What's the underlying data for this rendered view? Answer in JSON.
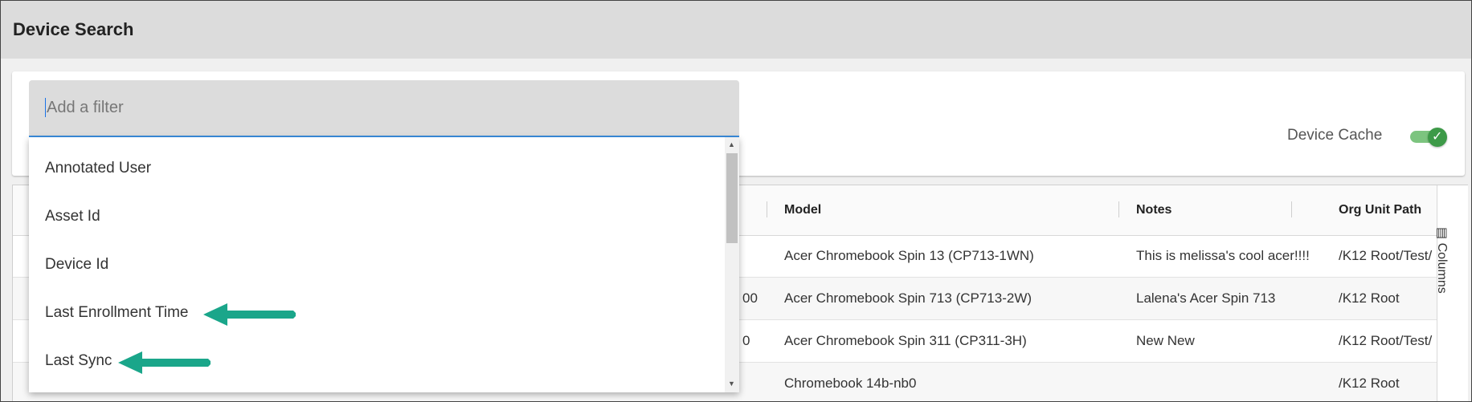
{
  "page": {
    "title": "Device Search"
  },
  "filter": {
    "placeholder": "Add a filter",
    "options": [
      "Annotated User",
      "Asset Id",
      "Device Id",
      "Last Enrollment Time",
      "Last Sync"
    ]
  },
  "device_cache": {
    "label": "Device Cache",
    "enabled": true
  },
  "table": {
    "columns": [
      "Model",
      "Notes",
      "Org Unit Path"
    ],
    "rows": [
      {
        "partial": "",
        "model": "Acer Chromebook Spin 13 (CP713-1WN)",
        "notes": "This is melissa's cool acer!!!!",
        "org": "/K12 Root/Test/"
      },
      {
        "partial": "00",
        "model": "Acer Chromebook Spin 713 (CP713-2W)",
        "notes": "Lalena's Acer Spin 713",
        "org": "/K12 Root"
      },
      {
        "partial": "0",
        "model": "Acer Chromebook Spin 311 (CP311-3H)",
        "notes": "New New",
        "org": "/K12 Root/Test/"
      },
      {
        "partial": "",
        "model": "Chromebook 14b-nb0",
        "notes": "",
        "org": "/K12 Root"
      }
    ]
  },
  "side_panel": {
    "columns_label": "Columns",
    "icon": "columns-icon"
  },
  "colors": {
    "accent": "#3a8dde",
    "arrow": "#1aa68a",
    "toggle": "#3d9a48"
  }
}
